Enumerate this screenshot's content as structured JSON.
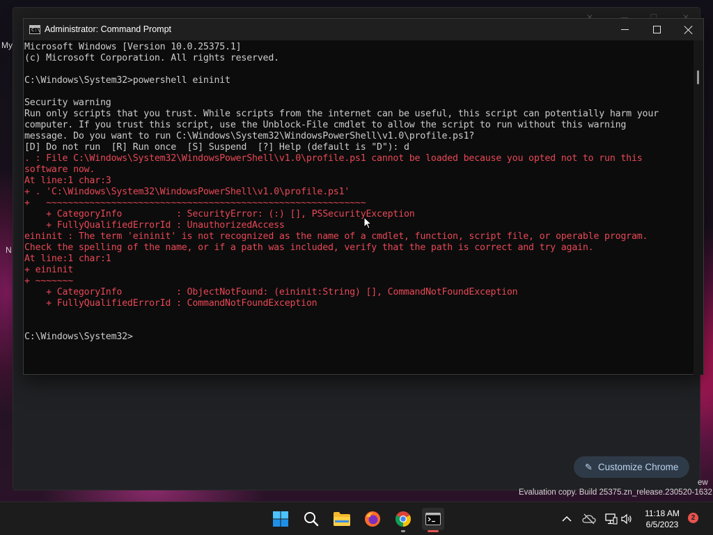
{
  "window": {
    "title": "Administrator: Command Prompt",
    "app_icon_text": "C:\\"
  },
  "console": {
    "lines": [
      {
        "text": "Microsoft Windows [Version 10.0.25375.1]",
        "style": "normal"
      },
      {
        "text": "(c) Microsoft Corporation. All rights reserved.",
        "style": "normal"
      },
      {
        "text": "",
        "style": "normal"
      },
      {
        "text": "C:\\Windows\\System32>powershell eininit",
        "style": "normal"
      },
      {
        "text": "",
        "style": "normal"
      },
      {
        "text": "Security warning",
        "style": "normal"
      },
      {
        "text": "Run only scripts that you trust. While scripts from the internet can be useful, this script can potentially harm your",
        "style": "normal"
      },
      {
        "text": "computer. If you trust this script, use the Unblock-File cmdlet to allow the script to run without this warning",
        "style": "normal"
      },
      {
        "text": "message. Do you want to run C:\\Windows\\System32\\WindowsPowerShell\\v1.0\\profile.ps1?",
        "style": "normal"
      },
      {
        "text": "[D] Do not run  [R] Run once  [S] Suspend  [?] Help (default is \"D\"): d",
        "style": "normal"
      },
      {
        "text": ". : File C:\\Windows\\System32\\WindowsPowerShell\\v1.0\\profile.ps1 cannot be loaded because you opted not to run this",
        "style": "error"
      },
      {
        "text": "software now.",
        "style": "error"
      },
      {
        "text": "At line:1 char:3",
        "style": "error"
      },
      {
        "text": "+ . 'C:\\Windows\\System32\\WindowsPowerShell\\v1.0\\profile.ps1'",
        "style": "error"
      },
      {
        "text": "+   ~~~~~~~~~~~~~~~~~~~~~~~~~~~~~~~~~~~~~~~~~~~~~~~~~~~~~~~~~~~",
        "style": "error"
      },
      {
        "text": "    + CategoryInfo          : SecurityError: (:) [], PSSecurityException",
        "style": "error"
      },
      {
        "text": "    + FullyQualifiedErrorId : UnauthorizedAccess",
        "style": "error"
      },
      {
        "text": "eininit : The term 'eininit' is not recognized as the name of a cmdlet, function, script file, or operable program.",
        "style": "error"
      },
      {
        "text": "Check the spelling of the name, or if a path was included, verify that the path is correct and try again.",
        "style": "error"
      },
      {
        "text": "At line:1 char:1",
        "style": "error"
      },
      {
        "text": "+ eininit",
        "style": "error"
      },
      {
        "text": "+ ~~~~~~~",
        "style": "error"
      },
      {
        "text": "    + CategoryInfo          : ObjectNotFound: (eininit:String) [], CommandNotFoundException",
        "style": "error"
      },
      {
        "text": "    + FullyQualifiedErrorId : CommandNotFoundException",
        "style": "error"
      },
      {
        "text": "",
        "style": "normal"
      },
      {
        "text": "",
        "style": "normal"
      },
      {
        "text": "C:\\Windows\\System32>",
        "style": "normal"
      }
    ]
  },
  "chrome": {
    "customize_label": "Customize Chrome"
  },
  "desktop": {
    "side_label_top": "My",
    "side_label_mid": "N",
    "watermark": "Evaluation copy. Build 25375.zn_release.230520-1632",
    "watermark_partial": "ew"
  },
  "taskbar": {
    "apps": [
      {
        "name": "start-button",
        "icon": "windows-logo"
      },
      {
        "name": "search-button",
        "icon": "search-icon"
      },
      {
        "name": "file-explorer",
        "icon": "folder-icon"
      },
      {
        "name": "firefox",
        "icon": "firefox-icon"
      },
      {
        "name": "chrome",
        "icon": "chrome-icon"
      },
      {
        "name": "terminal",
        "icon": "terminal-icon"
      }
    ],
    "clock_time": "11:18 AM",
    "clock_date": "6/5/2023",
    "notification_count": "2"
  },
  "colors": {
    "console_bg": "#0c0c0c",
    "console_text": "#cccccc",
    "error_text": "#e74856",
    "taskbar_bg": "#1c1c1c",
    "accent": "#60cdff"
  }
}
